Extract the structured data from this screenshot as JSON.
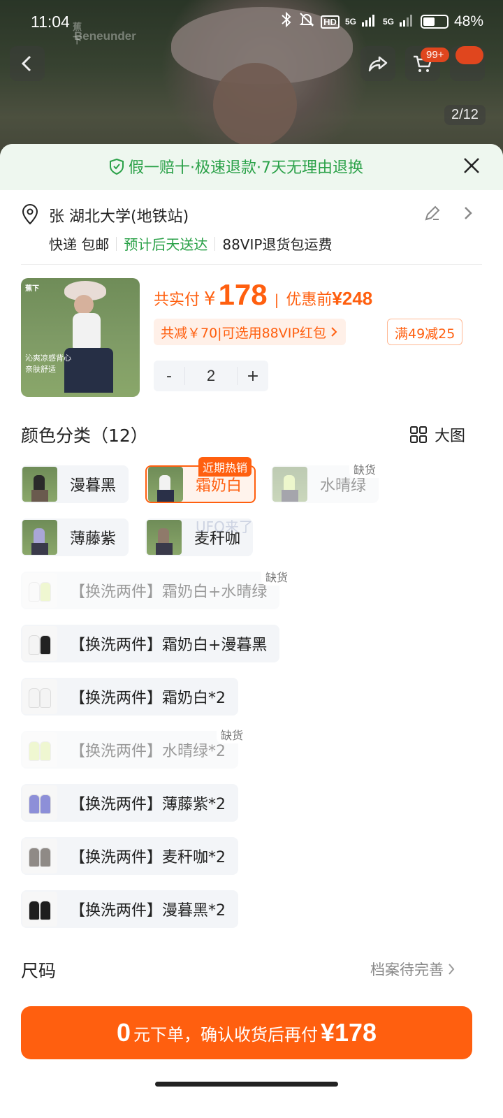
{
  "status_bar": {
    "time": "11:04",
    "brand_zh": "蕉下",
    "brand_en": "Beneunder",
    "network": "5G",
    "hd_badge": "HD",
    "battery": "48%"
  },
  "header": {
    "cart_count": "99+",
    "image_index": "2/12"
  },
  "guarantee": {
    "text": "假一赔十·极速退款·7天无理由退换",
    "accent_color": "#2aa148"
  },
  "address": {
    "line": "张 湖北大学(地铁站)",
    "shipping": "快递 包邮",
    "delivery": "预计后天送达",
    "vip_return": "88VIP退货包运费"
  },
  "product": {
    "thumb_brand": "蕉下",
    "thumb_slogan_1": "沁爽凉感背心",
    "thumb_slogan_2": "亲肤舒适",
    "paid_label": "共实付",
    "currency": "¥",
    "paid_amount": "178",
    "separator": "|",
    "before_label": "优惠前",
    "before_amount": "¥248",
    "discount_text": "共减￥70|可选用88VIP红包",
    "coupon": "满49减25",
    "quantity": "2",
    "minus": "-",
    "plus": "+",
    "accent_color": "#ff5f0f"
  },
  "color_section": {
    "title": "颜色分类（12）",
    "big_view": "大图",
    "hot_tag": "近期热销",
    "sold_out_tag": "缺货",
    "options": [
      {
        "label": "漫暮黑"
      },
      {
        "label": "霜奶白"
      },
      {
        "label": "水晴绿"
      },
      {
        "label": "薄藤紫"
      },
      {
        "label": "麦秆咖"
      },
      {
        "label": "【换洗两件】霜奶白+水晴绿"
      },
      {
        "label": "【换洗两件】霜奶白+漫暮黑"
      },
      {
        "label": "【换洗两件】霜奶白*2"
      },
      {
        "label": "【换洗两件】水晴绿*2"
      },
      {
        "label": "【换洗两件】薄藤紫*2"
      },
      {
        "label": "【换洗两件】麦秆咖*2"
      },
      {
        "label": "【换洗两件】漫暮黑*2"
      }
    ],
    "watermark": "UFO来了"
  },
  "size_section": {
    "title": "尺码",
    "profile_link": "档案待完善"
  },
  "cta": {
    "zero": "0",
    "text": "元下单，确认收货后再付",
    "amount": "¥178"
  }
}
